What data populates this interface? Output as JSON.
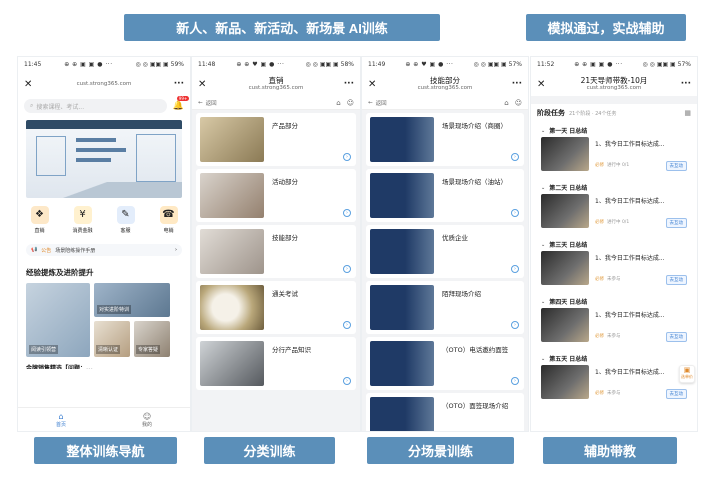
{
  "banners": {
    "top_left": "新人、新品、新活动、新场景 AI训练",
    "top_right": "模拟通过，实战辅助",
    "b1": "整体训练导航",
    "b2": "分类训练",
    "b3": "分场景训练",
    "b4": "辅助带教"
  },
  "p1": {
    "status_time": "11:45",
    "status_icons": "⊕ ⊕ ▣ ▣ ● ···",
    "status_right": "◎ ◎ ▣▣ ▣ 59%",
    "url": "cust.strong365.com",
    "search_placeholder": "搜索课程、考试...",
    "badge": "99+",
    "icons": [
      "直销",
      "消费金融",
      "客服",
      "电销"
    ],
    "notice_tag": "公告",
    "notice_text": "场景陪练操作手册",
    "section_title": "经验提炼及进阶提升",
    "tiles": [
      "对实进阶特训",
      "阅读引领营",
      "清晰认证",
      "专家答疑"
    ],
    "partial": "金牌销售精选【问题：...",
    "tab_home": "首页",
    "tab_mine": "我的"
  },
  "p2": {
    "status_time": "11:48",
    "status_icons": "⊕ ⊕ ♥ ▣ ● ···",
    "status_right": "◎ ◎ ▣▣ ▣ 58%",
    "title": "直销",
    "url": "cust.strong365.com",
    "back": "返回",
    "cards": [
      "产品部分",
      "活动部分",
      "技能部分",
      "通关考试",
      "分行产品知识"
    ]
  },
  "p3": {
    "status_time": "11:49",
    "status_icons": "⊕ ⊕ ♥ ▣ ● ···",
    "status_right": "◎ ◎ ▣▣ ▣ 57%",
    "title": "技能部分",
    "url": "cust.strong365.com",
    "back": "返回",
    "cards": [
      "场景现场介绍（商圈）",
      "场景现场介绍（油站）",
      "优质企业",
      "陌拜现场介绍",
      "（OTO）电话邀约面签",
      "（OTO）面签现场介绍"
    ]
  },
  "p4": {
    "status_time": "11:52",
    "status_icons": "⊕ ⊕ ▣ ▣ ● ···",
    "status_right": "◎ ◎ ▣▣ ▣ 57%",
    "title": "21天导师带教-10月",
    "url": "cust.strong365.com",
    "stage": "阶段任务",
    "stage_count": "21个阶段 · 24个任务",
    "days": [
      "第一天 日总结",
      "第二天 日总结",
      "第三天 日总结",
      "第四天 日总结",
      "第五天 日总结"
    ],
    "task": "1、我今日工作目标达成...",
    "tag": "必修",
    "states": [
      "进行中",
      "进行中",
      "未参与",
      "未参与",
      "未参与"
    ],
    "progress": [
      "0/1",
      "0/1",
      "",
      "",
      ""
    ],
    "btn": "去互动",
    "float": "选单价"
  }
}
